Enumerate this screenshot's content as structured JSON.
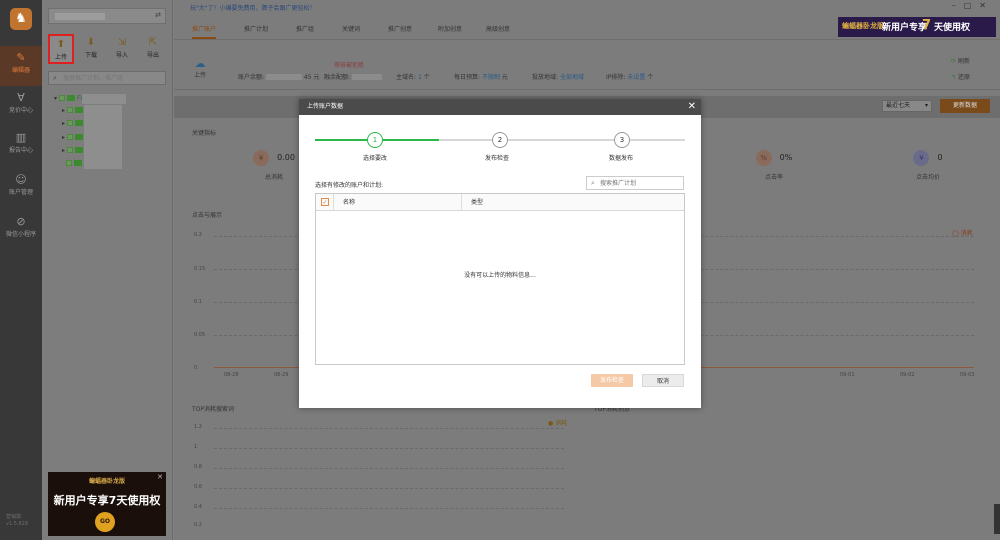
{
  "rail": {
    "items": [
      {
        "label": "编辑器",
        "icon": "edit-icon"
      },
      {
        "label": "竞价中心",
        "icon": "bid-icon"
      },
      {
        "label": "报告中心",
        "icon": "report-icon"
      },
      {
        "label": "账户管理",
        "icon": "account-icon"
      },
      {
        "label": "微信小程序",
        "icon": "miniprogram-icon"
      }
    ],
    "version": "营销猿\nv1.5.828"
  },
  "tree": {
    "tools": [
      {
        "label": "上传",
        "icon": "upload-icon"
      },
      {
        "label": "下载",
        "icon": "download-icon"
      },
      {
        "label": "导入",
        "icon": "import-icon"
      },
      {
        "label": "导出",
        "icon": "export-icon"
      }
    ],
    "search_placeholder": "搜索推广计划、推广组",
    "root_label": "Fl"
  },
  "ad_left": {
    "line1": "蝙蝠器卧龙版",
    "line2": "新用户专享7天使用权",
    "go": "GO"
  },
  "main": {
    "notice": "玩\"大\"了！小编要免费用，脾子会跟广更轻松！",
    "tabs": [
      "推广账户",
      "推广计划",
      "推广组",
      "关键词",
      "推广创意",
      "附加创意",
      "高级创意"
    ],
    "ad_top": {
      "a1": "蝙蝠器卧龙版",
      "a2": "新用户专享",
      "a3": "7",
      "a4": "天使用权"
    },
    "upload_label": "上传",
    "pending_review": "审核被拒绝",
    "balance_label": "账户余额:",
    "balance_value": "45",
    "currency": "元",
    "total_label": "融余配额:",
    "domain_label": "主域名:",
    "domain_count": "1",
    "unit_ge": "个",
    "budget_label": "每日预算:",
    "budget_value": "不限制",
    "region_label": "投放地域:",
    "region_value": "全部地域",
    "ip_label": "IP排除:",
    "ip_value": "未设置",
    "refresh_label": "刷新",
    "restore_label": "还原",
    "range_value": "最近七天",
    "update_btn": "更新数据",
    "key_metrics": "关键指标",
    "metrics": [
      {
        "icon": "¥",
        "value": "0.00",
        "label": "总消耗"
      },
      {
        "icon": "%",
        "value": "0%",
        "label": "点击率"
      },
      {
        "icon": "¥",
        "value": "0",
        "label": "点击均价"
      }
    ],
    "chart_title": "点击与展示",
    "chart_legend": "消耗",
    "y_ticks": [
      "0.2",
      "0.15",
      "0.1",
      "0.05",
      "0"
    ],
    "x_ticks": [
      "08-28",
      "08-29",
      "09-01",
      "09-02",
      "09-03"
    ],
    "top_kw_title": "TOP消耗搜索词",
    "top_legend": "消耗",
    "top_y_ticks": [
      "1.2",
      "1",
      "0.8",
      "0.6",
      "0.4",
      "0.2"
    ],
    "top_right_title": "TOP消耗创意"
  },
  "modal": {
    "title": "上传账户数据",
    "steps": [
      {
        "num": "1",
        "label": "选择要改"
      },
      {
        "num": "2",
        "label": "发布检查"
      },
      {
        "num": "3",
        "label": "数据发布"
      }
    ],
    "prompt": "选择有修改的账户和计划:",
    "search_placeholder": "搜索推广计划",
    "columns": [
      "名称",
      "类型"
    ],
    "empty_text": "没有可以上传的物料信息...",
    "primary_btn": "发布检查",
    "cancel_btn": "取消"
  },
  "colors": {
    "accent_green": "#2cb84a",
    "accent_orange": "#e07b3c",
    "modal_header": "#4b4b4b"
  }
}
